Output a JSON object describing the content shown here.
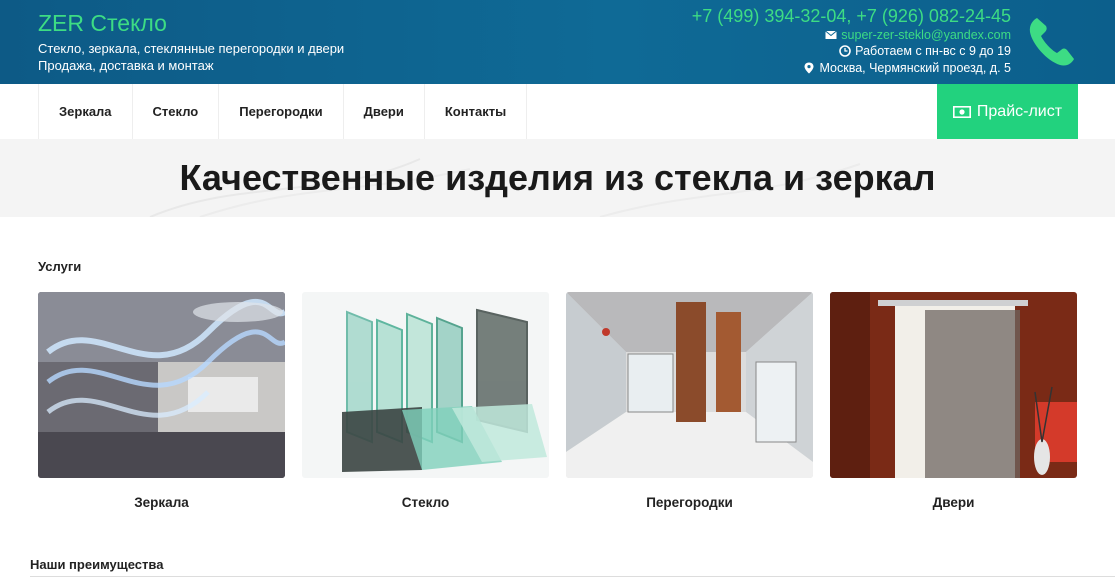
{
  "header": {
    "brand": "ZER Стекло",
    "tagline1": "Стекло, зеркала, стеклянные перегородки и двери",
    "tagline2": "Продажа, доставка и монтаж",
    "phones": "+7 (499) 394-32-04, +7 (926) 082-24-45",
    "email": "super-zer-steklo@yandex.com",
    "hours": "Работаем с пн-вс с 9 до 19",
    "address": "Москва, Чермянский проезд, д. 5"
  },
  "nav": {
    "items": [
      "Зеркала",
      "Стекло",
      "Перегородки",
      "Двери",
      "Контакты"
    ],
    "price_button": "Прайс-лист"
  },
  "hero": {
    "title": "Качественные изделия из стекла и зеркал"
  },
  "services": {
    "heading": "Услуги",
    "cards": [
      {
        "label": "Зеркала"
      },
      {
        "label": "Стекло"
      },
      {
        "label": "Перегородки"
      },
      {
        "label": "Двери"
      }
    ]
  },
  "advantages": {
    "heading": "Наши преимущества"
  },
  "colors": {
    "header_bg": "#0f6a96",
    "accent": "#3ddc84",
    "button": "#22d27e"
  },
  "icons": [
    "envelope-icon",
    "clock-icon",
    "map-marker-icon",
    "phone-icon",
    "money-icon"
  ]
}
